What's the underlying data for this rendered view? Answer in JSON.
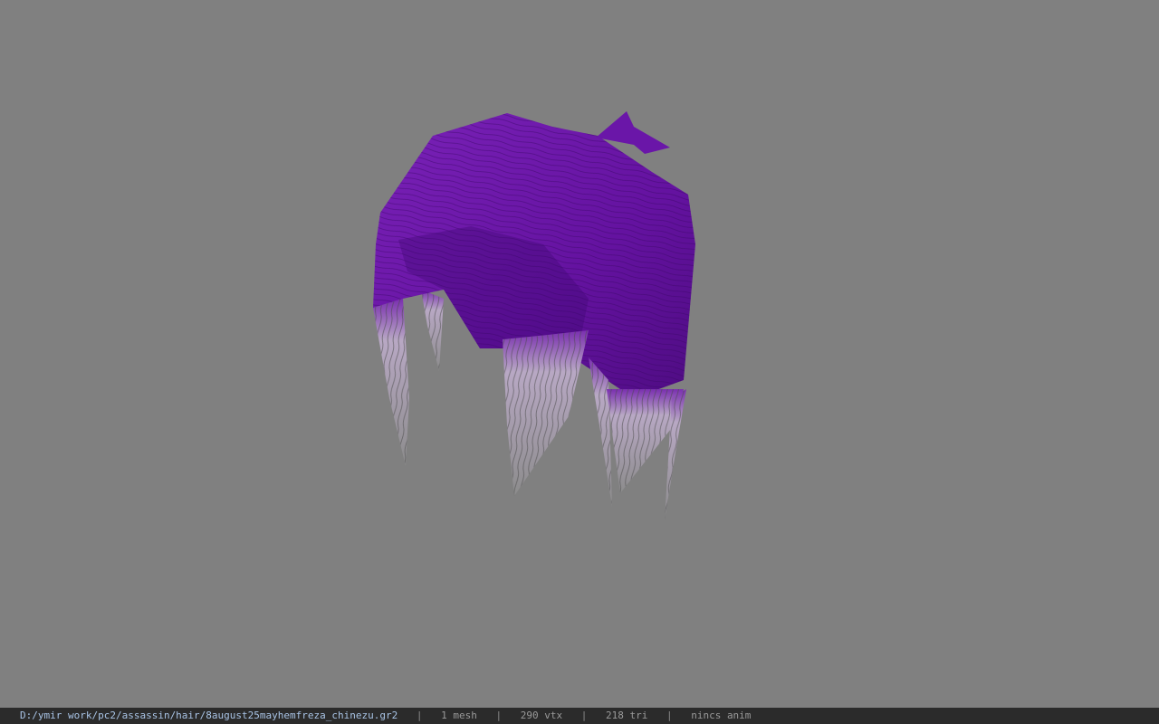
{
  "viewer": {
    "background_color": "#808080",
    "model_name": "hair-model",
    "hair_color": "#6a1aa0",
    "tip_color": "#c9c9c9"
  },
  "status": {
    "path": "D:/ymir work/pc2/assassin/hair/8august25mayhemfreza_chinezu.gr2",
    "separator": "|",
    "mesh": "1 mesh",
    "vtx": "290 vtx",
    "tri": "218 tri",
    "anim": "nincs anim"
  }
}
